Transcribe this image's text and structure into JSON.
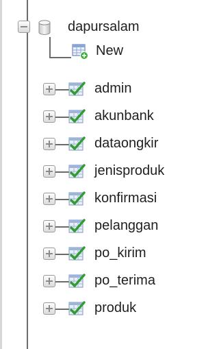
{
  "database": {
    "name": "dapursalam",
    "expanded": true
  },
  "new_item": {
    "label": "New"
  },
  "tables": [
    {
      "name": "admin"
    },
    {
      "name": "akunbank"
    },
    {
      "name": "dataongkir"
    },
    {
      "name": "jenisproduk"
    },
    {
      "name": "konfirmasi"
    },
    {
      "name": "pelanggan"
    },
    {
      "name": "po_kirim"
    },
    {
      "name": "po_terima"
    },
    {
      "name": "produk"
    }
  ]
}
